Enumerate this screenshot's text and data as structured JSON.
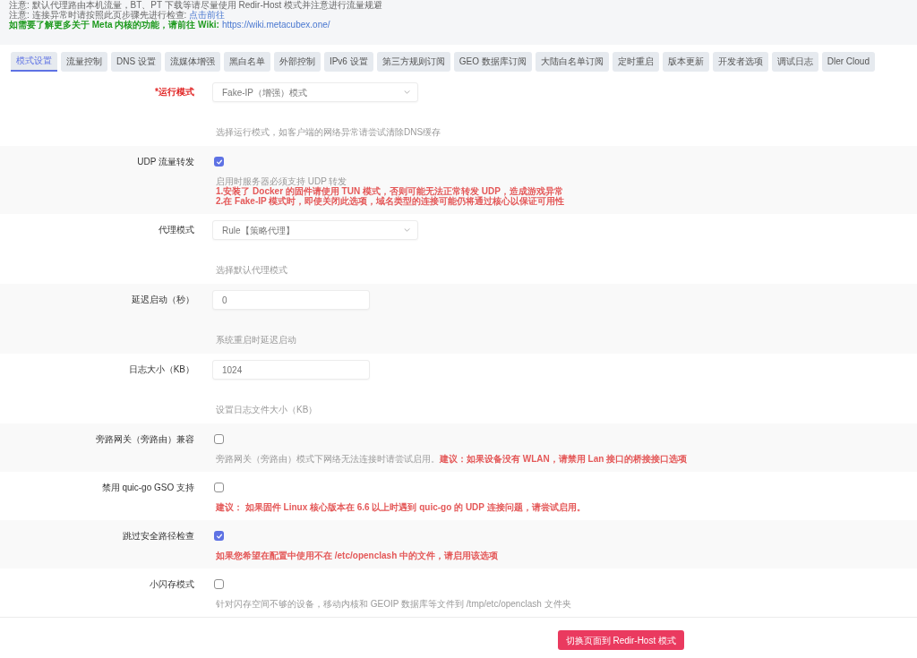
{
  "notices": [
    {
      "kind": "note",
      "text": "注意: 默认代理路由本机流量，BT、PT 下载等请尽量使用 Redir-Host 模式并注意进行流量规避"
    },
    {
      "kind": "note",
      "text": "注意: 连接异常时请按照此页步骤先进行检查:",
      "link": "点击前往"
    },
    {
      "kind": "highlight",
      "text": "如需要了解更多关于 Meta 内核的功能，请前往 Wiki:",
      "link": "https://wiki.metacubex.one/"
    }
  ],
  "tabs": [
    {
      "label": "模式设置",
      "selected": true
    },
    {
      "label": "流量控制",
      "selected": false
    },
    {
      "label": "DNS 设置",
      "selected": false
    },
    {
      "label": "流媒体增强",
      "selected": false
    },
    {
      "label": "黑白名单",
      "selected": false
    },
    {
      "label": "外部控制",
      "selected": false
    },
    {
      "label": "IPv6 设置",
      "selected": false
    },
    {
      "label": "第三方规则订阅",
      "selected": false
    },
    {
      "label": "GEO 数据库订阅",
      "selected": false
    },
    {
      "label": "大陆白名单订阅",
      "selected": false
    },
    {
      "label": "定时重启",
      "selected": false
    },
    {
      "label": "版本更新",
      "selected": false
    },
    {
      "label": "开发者选项",
      "selected": false
    },
    {
      "label": "调试日志",
      "selected": false
    },
    {
      "label": "Dler Cloud",
      "selected": false
    }
  ],
  "fields": [
    {
      "kind": "select",
      "label": "*运行模式",
      "required": true,
      "value": "Fake-IP（增强）模式",
      "description": [
        [
          {
            "kind": "hint",
            "text": "选择运行模式，如客户端的网络异常请尝试清除DNS缓存"
          }
        ]
      ]
    },
    {
      "kind": "checkbox",
      "label": "UDP 流量转发",
      "required": false,
      "checked": true,
      "description": [
        [
          {
            "kind": "hint",
            "text": "启用时服务器必须支持 UDP 转发"
          }
        ],
        [
          {
            "kind": "warning",
            "text": "1.安装了 Docker 的固件请使用 TUN 模式，否则可能无法正常转发 UDP，造成游戏异常"
          }
        ],
        [
          {
            "kind": "warning",
            "text": "2.在 Fake-IP 模式时，即使关闭此选项，域名类型的连接可能仍将通过核心以保证可用性"
          }
        ]
      ]
    },
    {
      "kind": "select",
      "label": "代理模式",
      "required": false,
      "value": "Rule【策略代理】",
      "description": [
        [
          {
            "kind": "hint",
            "text": "选择默认代理模式"
          }
        ]
      ]
    },
    {
      "kind": "text",
      "label": "延迟启动（秒）",
      "required": false,
      "value": "0",
      "description": [
        [
          {
            "kind": "hint",
            "text": "系统重启时延迟启动"
          }
        ]
      ]
    },
    {
      "kind": "text",
      "label": "日志大小（KB）",
      "required": false,
      "value": "1024",
      "description": [
        [
          {
            "kind": "hint",
            "text": "设置日志文件大小（KB）"
          }
        ]
      ]
    },
    {
      "kind": "checkbox",
      "label": "旁路网关（旁路由）兼容",
      "required": false,
      "checked": false,
      "description": [
        [
          {
            "kind": "hint",
            "text": "旁路网关（旁路由）模式下网络无法连接时请尝试启用。"
          },
          {
            "kind": "warning",
            "text": "建议：如果设备没有 WLAN，请禁用 Lan 接口的桥接接口选项"
          }
        ]
      ]
    },
    {
      "kind": "checkbox",
      "label": "禁用 quic-go GSO 支持",
      "required": false,
      "checked": false,
      "description": [
        [
          {
            "kind": "warning",
            "text": "建议： 如果固件 Linux 核心版本在 6.6 以上时遇到 quic-go 的 UDP 连接问题，请尝试启用。"
          }
        ]
      ]
    },
    {
      "kind": "checkbox",
      "label": "跳过安全路径检查",
      "required": false,
      "checked": true,
      "description": [
        [
          {
            "kind": "warning",
            "text": "如果您希望在配置中使用不在 /etc/openclash 中的文件，请启用该选项"
          }
        ]
      ]
    },
    {
      "kind": "checkbox",
      "label": "小闪存模式",
      "required": false,
      "checked": false,
      "description": [
        [
          {
            "kind": "hint",
            "text": "针对闪存空间不够的设备，移动内核和 GEOIP 数据库等文件到 /tmp/etc/openclash 文件夹"
          }
        ]
      ]
    }
  ],
  "switch_button": {
    "label": "切换页面到 Redir-Host 模式"
  }
}
